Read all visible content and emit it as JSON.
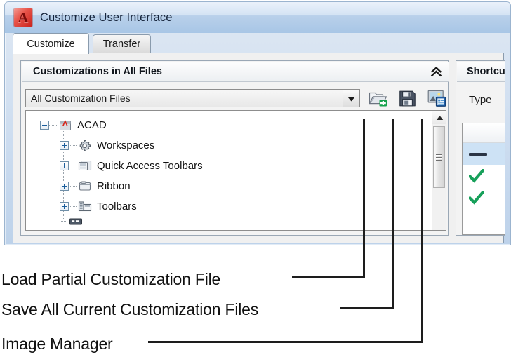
{
  "window": {
    "title": "Customize User Interface",
    "app_icon": "autocad-a-icon",
    "app_icon_letter": "A"
  },
  "tabs": [
    {
      "label": "Customize",
      "active": true
    },
    {
      "label": "Transfer",
      "active": false
    }
  ],
  "left_pane": {
    "header": "Customizations in All Files",
    "collapse_icon": "double-chevron-up-icon",
    "combo": {
      "value": "All Customization Files",
      "arrow_icon": "chevron-down-icon"
    },
    "toolbar": [
      {
        "name": "load-partial-customization-file-button",
        "icon": "open-folder-plus-icon"
      },
      {
        "name": "save-all-current-customization-files-button",
        "icon": "floppy-disk-save-icon"
      },
      {
        "name": "image-manager-button",
        "icon": "image-manager-icon"
      }
    ],
    "tree": [
      {
        "label": "ACAD",
        "icon": "autocad-file-icon",
        "state": "expanded",
        "level": 0
      },
      {
        "label": "Workspaces",
        "icon": "gear-icon",
        "state": "collapsed",
        "level": 1
      },
      {
        "label": "Quick Access Toolbars",
        "icon": "quick-access-toolbar-icon",
        "state": "collapsed",
        "level": 1
      },
      {
        "label": "Ribbon",
        "icon": "ribbon-icon",
        "state": "collapsed",
        "level": 1
      },
      {
        "label": "Toolbars",
        "icon": "toolbars-icon",
        "state": "collapsed",
        "level": 1
      }
    ],
    "scrollbar": {
      "up_icon": "scroll-up-arrow-icon",
      "thumb_grip_icon": "grip-lines-icon"
    }
  },
  "right_pane": {
    "header": "Shortcuts",
    "sub_label": "Type",
    "rows": [
      {
        "icon": "",
        "selected": false
      },
      {
        "icon": "dash-icon",
        "selected": true
      },
      {
        "icon": "green-check-icon",
        "selected": false
      },
      {
        "icon": "green-check-icon",
        "selected": false
      }
    ]
  },
  "callouts": [
    {
      "label": "Load Partial Customization File",
      "target": "load-partial-customization-file-button"
    },
    {
      "label": "Save All Current Customization Files",
      "target": "save-all-current-customization-files-button"
    },
    {
      "label": "Image Manager",
      "target": "image-manager-button"
    }
  ],
  "colors": {
    "titlebar_blue": "#a8c6e6",
    "accent_red": "#c9221c",
    "green_check": "#17a05a",
    "green_plus": "#16a14b",
    "selection_blue": "#cde2f5"
  }
}
